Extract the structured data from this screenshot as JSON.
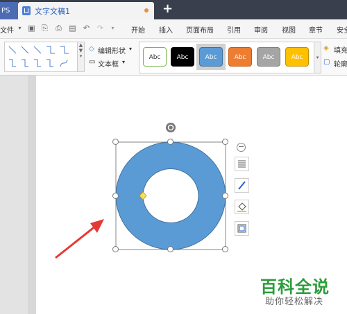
{
  "tabs": {
    "app_label": "PS",
    "doc_title": "文字文稿1",
    "add_label": "+"
  },
  "menu": {
    "file_label": "文件",
    "items": [
      "开始",
      "插入",
      "页面布局",
      "引用",
      "审阅",
      "视图",
      "章节",
      "安全"
    ]
  },
  "ribbon": {
    "edit_shape": "编辑形状",
    "text_box": "文本框",
    "fill": "填充",
    "outline": "轮廓",
    "style_buttons": [
      {
        "label": "Abc",
        "bg": "#ffffff",
        "border": "#7ab648",
        "fg": "#333333"
      },
      {
        "label": "Abc",
        "bg": "#000000",
        "border": "#000000",
        "fg": "#ffffff"
      },
      {
        "label": "Abc",
        "bg": "#5b9bd5",
        "border": "#41719c",
        "fg": "#ffffff"
      },
      {
        "label": "Abc",
        "bg": "#ed7d31",
        "border": "#c55a11",
        "fg": "#ffffff"
      },
      {
        "label": "Abc",
        "bg": "#a5a5a5",
        "border": "#7f7f7f",
        "fg": "#ffffff"
      },
      {
        "label": "Abc",
        "bg": "#ffc000",
        "border": "#bf9000",
        "fg": "#ffffff"
      }
    ]
  },
  "shape": {
    "fill_color": "#5b9bd5",
    "stroke_color": "#41719c"
  },
  "watermark": {
    "title": "百科全说",
    "subtitle": "助你轻松解决"
  }
}
